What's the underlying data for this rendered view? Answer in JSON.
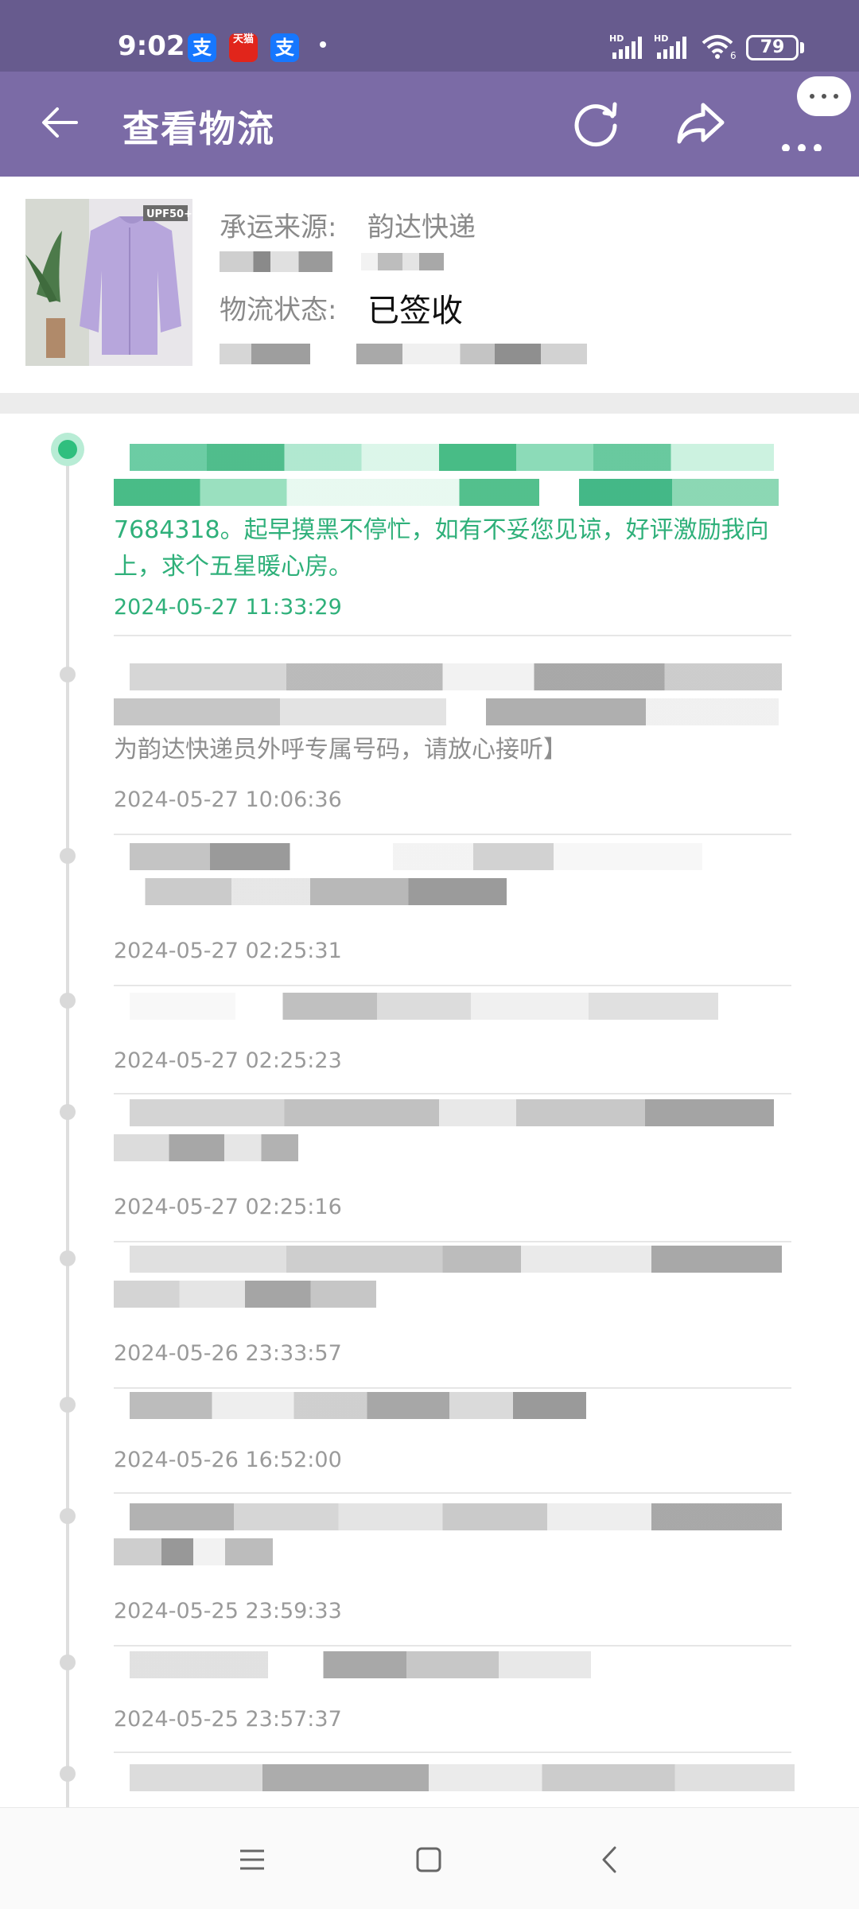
{
  "status_bar": {
    "time": "9:02",
    "battery": "79",
    "apps": [
      {
        "name": "alipay-badge",
        "glyph": "支",
        "color": "#1677ff"
      },
      {
        "name": "tmall-badge",
        "glyph": "天猫",
        "color": "#e1251b"
      },
      {
        "name": "alipay-badge-2",
        "glyph": "支",
        "color": "#1677ff"
      }
    ]
  },
  "header": {
    "title": "查看物流",
    "icons": [
      "back-arrow-icon",
      "refresh-icon",
      "share-icon",
      "more-icon"
    ]
  },
  "package": {
    "carrier_label": "承运来源:",
    "carrier_value": "韵达快递",
    "status_label": "物流状态:",
    "status_value": "已签收",
    "thumb_badge": "UPF50+"
  },
  "events": [
    {
      "text": "7684318。起早摸黑不停忙，如有不妥您见谅，好评激励我向上，求个五星暖心房。",
      "time": "2024-05-27 11:33:29",
      "active": true
    },
    {
      "text": "为韵达快递员外呼专属号码，请放心接听】",
      "time": "2024-05-27 10:06:36"
    },
    {
      "text": "",
      "time": "2024-05-27 02:25:31"
    },
    {
      "text": "",
      "time": "2024-05-27 02:25:23"
    },
    {
      "text": "",
      "time": "2024-05-27 02:25:16"
    },
    {
      "text": "",
      "time": "2024-05-26 23:33:57"
    },
    {
      "text": "",
      "time": "2024-05-26 16:52:00"
    },
    {
      "text": "",
      "time": "2024-05-25 23:59:33"
    },
    {
      "text": "",
      "time": "2024-05-25 23:57:37"
    },
    {
      "text": "",
      "time": ""
    }
  ],
  "colors": {
    "status_bar": "#675b8e",
    "header": "#7b6ba6",
    "accent_green": "#2fb07a"
  }
}
